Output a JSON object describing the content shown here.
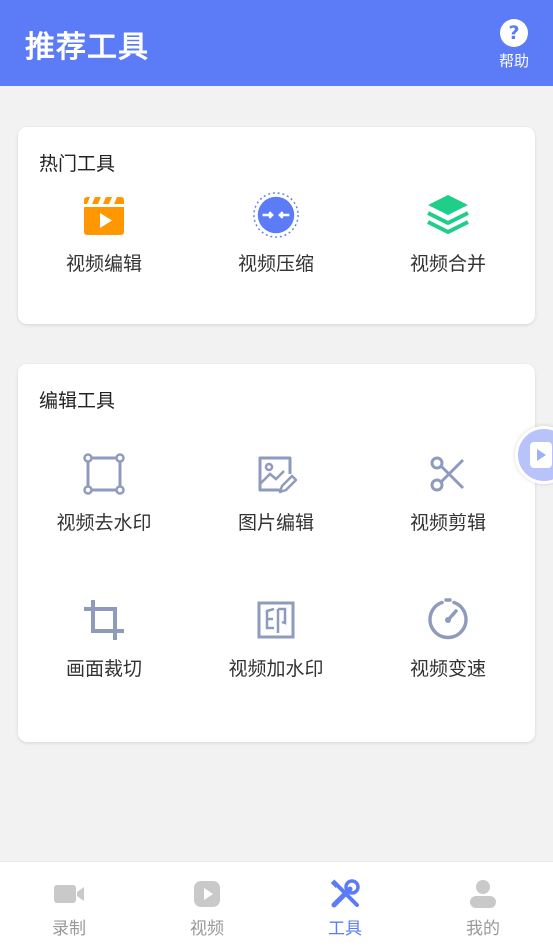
{
  "header": {
    "title": "推荐工具",
    "help_label": "帮助",
    "help_glyph": "?"
  },
  "hot": {
    "title": "热门工具",
    "items": [
      {
        "label": "视频编辑",
        "icon": "video-edit-icon"
      },
      {
        "label": "视频压缩",
        "icon": "video-compress-icon"
      },
      {
        "label": "视频合并",
        "icon": "video-merge-icon"
      }
    ]
  },
  "edit": {
    "title": "编辑工具",
    "items": [
      {
        "label": "视频去水印",
        "icon": "crop-square-icon"
      },
      {
        "label": "图片编辑",
        "icon": "image-edit-icon"
      },
      {
        "label": "视频剪辑",
        "icon": "scissors-icon"
      },
      {
        "label": "画面裁切",
        "icon": "crop-icon"
      },
      {
        "label": "视频加水印",
        "icon": "watermark-stamp-icon"
      },
      {
        "label": "视频变速",
        "icon": "speed-gauge-icon"
      }
    ]
  },
  "tabs": [
    {
      "label": "录制",
      "icon": "camera-icon"
    },
    {
      "label": "视频",
      "icon": "play-icon"
    },
    {
      "label": "工具",
      "icon": "tools-icon",
      "active": true
    },
    {
      "label": "我的",
      "icon": "user-icon"
    }
  ],
  "colors": {
    "primary": "#5b7cf6",
    "icon_gray": "#8f9bbd",
    "orange": "#ff9800",
    "green": "#1fce8a"
  }
}
